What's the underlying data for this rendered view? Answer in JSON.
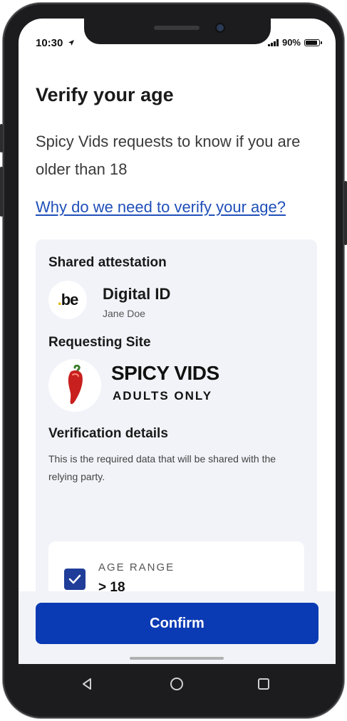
{
  "status_bar": {
    "time": "10:30",
    "battery": "90%"
  },
  "page": {
    "title": "Verify your age",
    "subtitle": "Spicy Vids requests to know if you are older than 18",
    "link": "Why do we need to verify your age?"
  },
  "attestation": {
    "label": "Shared attestation",
    "logo_text": "be",
    "name": "Digital ID",
    "holder": "Jane Doe"
  },
  "requesting_site": {
    "label": "Requesting Site",
    "name": "SPICY VIDS",
    "tagline": "ADULTS ONLY"
  },
  "verification": {
    "label": "Verification details",
    "description": "This is the required data that will be shared with the relying party.",
    "attribute_label": "AGE RANGE",
    "attribute_value": "> 18",
    "attribute_checked": true
  },
  "confirm_label": "Confirm",
  "icons": {
    "location": "location-arrow-icon",
    "back": "back-triangle-icon",
    "home": "home-circle-icon",
    "recents": "recents-square-icon"
  },
  "colors": {
    "primary": "#0a3ab4",
    "link": "#1f4fb8",
    "card_bg": "#f1f3f8",
    "checkbox": "#1f3d99"
  }
}
